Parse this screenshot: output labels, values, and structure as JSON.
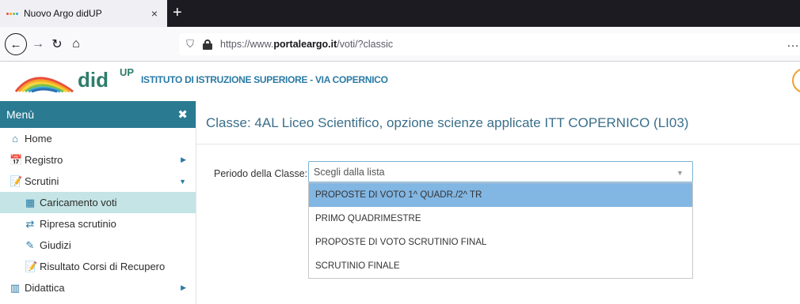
{
  "browser": {
    "tab_title": "Nuovo Argo didUP",
    "tab_close": "×",
    "new_tab": "+",
    "url_prefix": "https://www.",
    "url_domain": "portaleargo.it",
    "url_path": "/voti/?classic",
    "more": "…"
  },
  "header": {
    "logo_word": "did",
    "logo_sup": "UP",
    "school": "ISTITUTO DI ISTRUZIONE SUPERIORE - VIA COPERNICO"
  },
  "sidebar": {
    "title": "Menù",
    "close": "✖",
    "items": [
      {
        "label": "Home",
        "icon": "⌂",
        "icon_name": "home-icon",
        "level": 0,
        "arrow": ""
      },
      {
        "label": "Registro",
        "icon": "📅",
        "icon_name": "calendar-icon",
        "level": 0,
        "arrow": "▶"
      },
      {
        "label": "Scrutini",
        "icon": "📝",
        "icon_name": "scrutini-icon",
        "level": 0,
        "arrow": "▼"
      },
      {
        "label": "Caricamento voti",
        "icon": "▦",
        "icon_name": "grid-icon",
        "level": 1,
        "arrow": "",
        "active": true
      },
      {
        "label": "Ripresa scrutinio",
        "icon": "⇄",
        "icon_name": "retweet-icon",
        "level": 1,
        "arrow": ""
      },
      {
        "label": "Giudizi",
        "icon": "✎",
        "icon_name": "edit-icon",
        "level": 1,
        "arrow": ""
      },
      {
        "label": "Risultato Corsi di Recupero",
        "icon": "📝",
        "icon_name": "document-icon",
        "level": 1,
        "arrow": ""
      },
      {
        "label": "Didattica",
        "icon": "▥",
        "icon_name": "columns-icon",
        "level": 0,
        "arrow": "▶"
      }
    ]
  },
  "main": {
    "title": "Classe: 4AL Liceo Scientifico, opzione scienze applicate ITT COPERNICO (LI03)",
    "periodo_label": "Periodo della Classe:",
    "select_placeholder": "Scegli dalla lista",
    "options": [
      "PROPOSTE DI VOTO 1^ QUADR./2^ TR",
      "PRIMO QUADRIMESTRE",
      "PROPOSTE DI VOTO SCRUTINIO FINAL",
      "SCRUTINIO FINALE"
    ],
    "highlighted_option": 0
  },
  "colors": {
    "menu_header": "#2a7a91",
    "active_item": "#c4e4e5",
    "highlight_option": "#82b6e3",
    "title": "#3a6e8a"
  }
}
